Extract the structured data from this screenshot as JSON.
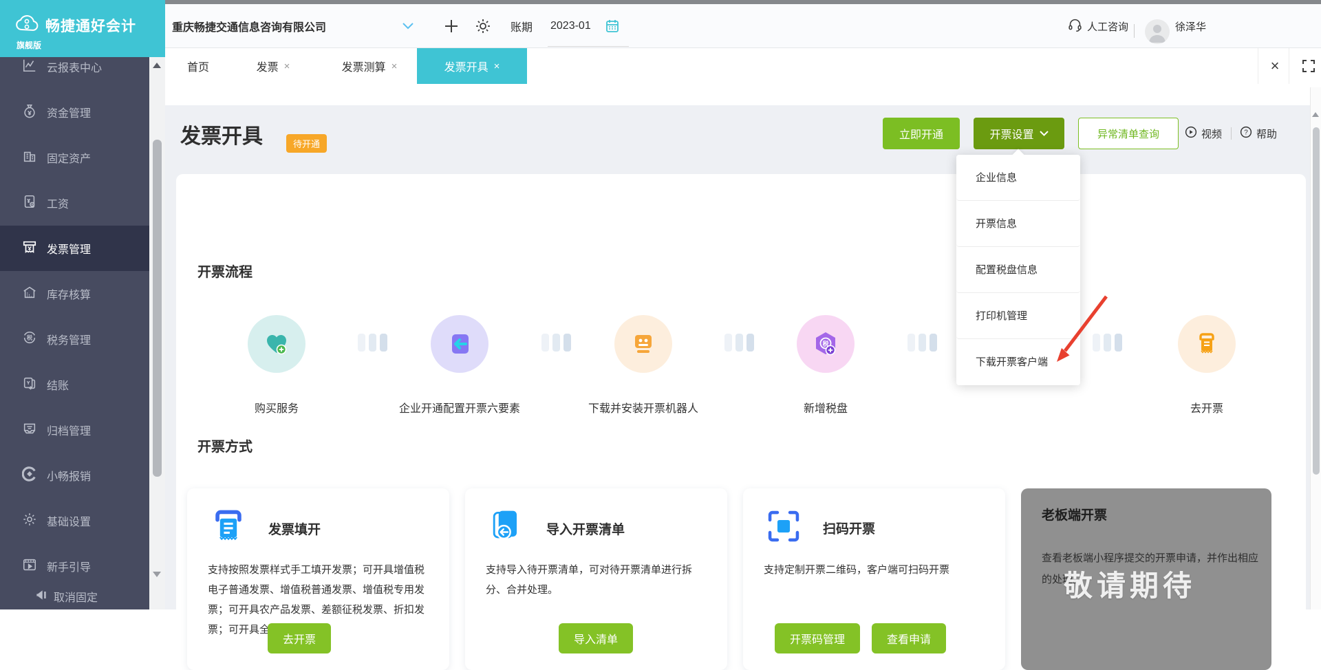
{
  "brand": {
    "name": "畅捷通好会计",
    "edition": "旗舰版"
  },
  "topbar": {
    "company": "重庆畅捷交通信息咨询有限公司",
    "period_label": "账期",
    "period_value": "2023-01",
    "support": "人工咨询",
    "username": "徐泽华"
  },
  "tabs": [
    {
      "label": "首页",
      "close": ""
    },
    {
      "label": "发票",
      "close": "×"
    },
    {
      "label": "发票测算",
      "close": "×"
    },
    {
      "label": "发票开具",
      "close": "×"
    }
  ],
  "tabbar": {
    "close_all": "×"
  },
  "sidebar": {
    "items": [
      {
        "label": "云报表中心",
        "icon": "chart-line-icon"
      },
      {
        "label": "资金管理",
        "icon": "money-bag-icon"
      },
      {
        "label": "固定资产",
        "icon": "building-icon"
      },
      {
        "label": "工资",
        "icon": "payroll-doc-icon"
      },
      {
        "label": "发票管理",
        "icon": "invoice-machine-icon"
      },
      {
        "label": "库存核算",
        "icon": "warehouse-icon"
      },
      {
        "label": "税务管理",
        "icon": "tax-icon"
      },
      {
        "label": "结账",
        "icon": "checkout-cards-icon"
      },
      {
        "label": "归档管理",
        "icon": "archive-tray-icon"
      },
      {
        "label": "小畅报销",
        "icon": "reimburse-icon"
      },
      {
        "label": "基础设置",
        "icon": "gear-icon"
      },
      {
        "label": "新手引导",
        "icon": "guide-video-icon"
      }
    ],
    "unpin": "取消固定"
  },
  "page": {
    "title": "发票开具",
    "badge": "待开通"
  },
  "actions": {
    "activate": "立即开通",
    "settings": "开票设置",
    "abnormal": "异常清单查询",
    "video": "视频",
    "help": "帮助"
  },
  "settings_menu": {
    "items": [
      "企业信息",
      "开票信息",
      "配置税盘信息",
      "打印机管理",
      "下载开票客户端"
    ]
  },
  "flow": {
    "title": "开票流程",
    "steps": [
      {
        "label": "购买服务",
        "icon": "heart-plus-icon"
      },
      {
        "label": "企业开通配置开票六要素",
        "icon": "purple-doc-arrow-icon"
      },
      {
        "label": "下载并安装开票机器人",
        "icon": "robot-invoice-icon"
      },
      {
        "label": "新增税盘",
        "icon": "tax-disk-plus-icon"
      },
      {
        "label": "去开票",
        "icon": "orange-printer-icon"
      }
    ]
  },
  "methods": {
    "title": "开票方式",
    "cards": [
      {
        "title": "发票填开",
        "icon": "blue-invoice-printer-icon",
        "desc": "支持按照发票样式手工填开发票；可开具增值税电子普通发票、增值税普通发票、增值税专用发票；可开具农产品发票、差额征税发票、折扣发票；可开具全电专票、",
        "buttons": [
          "去开票"
        ]
      },
      {
        "title": "导入开票清单",
        "icon": "blue-import-list-icon",
        "desc": "支持导入待开票清单，可对待开票清单进行拆分、合并处理。",
        "buttons": [
          "导入清单"
        ]
      },
      {
        "title": "扫码开票",
        "icon": "blue-scan-code-icon",
        "desc": "支持定制开票二维码，客户端可扫码开票",
        "buttons": [
          "开票码管理",
          "查看申请"
        ]
      },
      {
        "title": "老板端开票",
        "disabled": true,
        "desc": "查看老板端小程序提交的开票申请，并作出相应的处理。",
        "watermark": "敬请期待",
        "buttons": []
      }
    ]
  },
  "colors": {
    "brand_teal": "#3fc4d4",
    "button_green": "#7cbe23",
    "button_dark_green": "#6b9b10",
    "badge_orange": "#f7a728",
    "sidebar_bg": "#474b60",
    "red_arrow": "#e8402f"
  }
}
